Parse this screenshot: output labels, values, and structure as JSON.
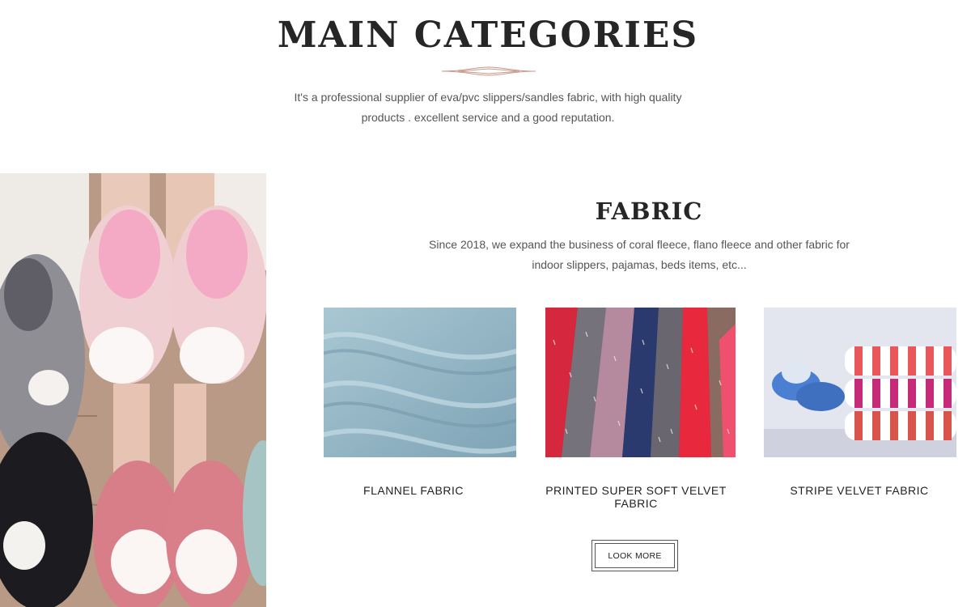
{
  "header": {
    "title": "MAIN CATEGORIES",
    "intro_line1": "It's a professional supplier of eva/pvc slippers/sandles fabric, with high quality",
    "intro_line2": "products . excellent service and a good reputation."
  },
  "category": {
    "title": "FABRIC",
    "desc_line1": "Since 2018, we expand the business of coral fleece, flano fleece and other fabric for",
    "desc_line2": "indoor slippers, pajamas, beds items, etc..."
  },
  "products": [
    {
      "name": "FLANNEL FABRIC"
    },
    {
      "name": "PRINTED SUPER SOFT VELVET FABRIC"
    },
    {
      "name": "STRIPE VELVET FABRIC"
    }
  ],
  "buttons": {
    "look_more": "LOOK MORE"
  },
  "colors": {
    "heading": "#262626",
    "body_text": "#555555",
    "ornament": "#c79a8c",
    "flannel": "#8fb4c4",
    "velvet_red": "#e8283c",
    "velvet_navy": "#2a3a6e",
    "stripe_red": "#e25a50"
  }
}
